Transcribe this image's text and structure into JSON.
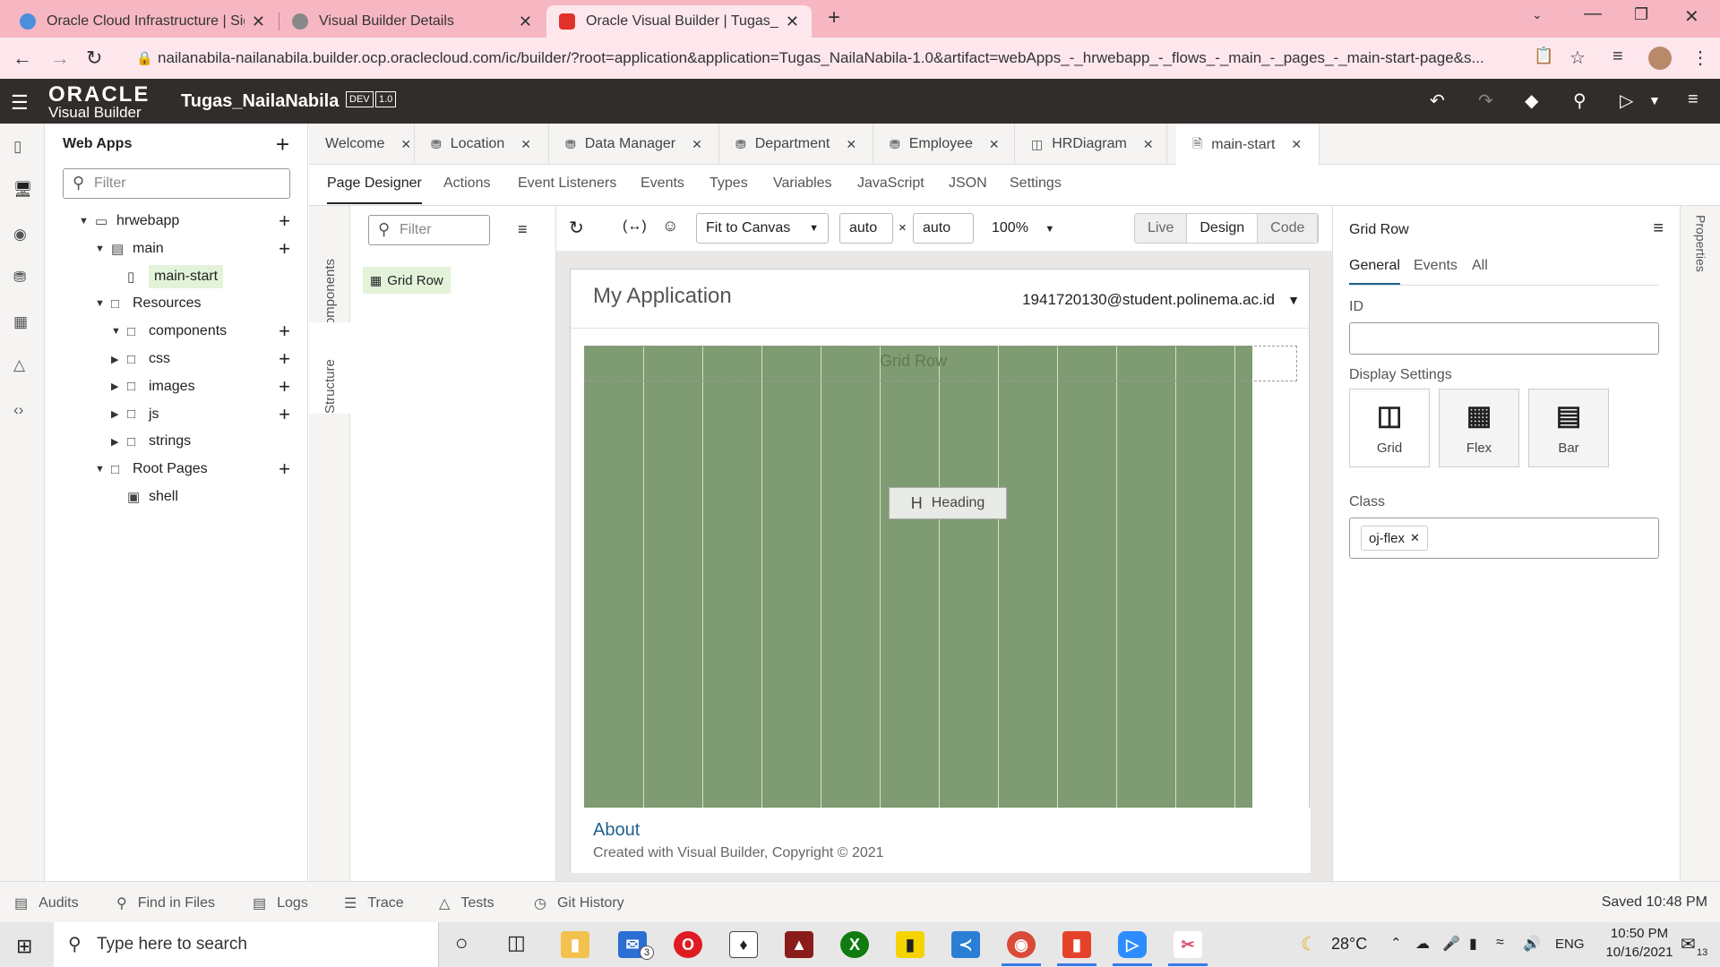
{
  "browser": {
    "tabs": [
      {
        "title": "Oracle Cloud Infrastructure | Sign",
        "close": "✕"
      },
      {
        "title": "Visual Builder Details",
        "close": "✕"
      },
      {
        "title": "Oracle Visual Builder | Tugas_Nai",
        "close": "✕"
      }
    ],
    "new_tab": "+",
    "url": "nailanabila-nailanabila.builder.ocp.oraclecloud.com/ic/builder/?root=application&application=Tugas_NailaNabila-1.0&artifact=webApps_-_hrwebapp_-_flows_-_main_-_pages_-_main-start-page&s..."
  },
  "vb_header": {
    "logo_line1": "ORACLE",
    "logo_line2": "Visual Builder",
    "app_name": "Tugas_NailaNabila",
    "badge_dev": "DEV",
    "badge_version": "1.0"
  },
  "navigator": {
    "title": "Web Apps",
    "filter_placeholder": "Filter",
    "tree": [
      {
        "label": "hrwebapp",
        "indent": 1,
        "twisty": "▼",
        "icon": "monitor-icon",
        "add": true
      },
      {
        "label": "main",
        "indent": 2,
        "twisty": "▼",
        "icon": "flow-icon",
        "add": true
      },
      {
        "label": "main-start",
        "indent": 3,
        "twisty": "",
        "icon": "page-icon",
        "add": false,
        "selected": true
      },
      {
        "label": "Resources",
        "indent": 2,
        "twisty": "▼",
        "icon": "folder-icon",
        "add": false
      },
      {
        "label": "components",
        "indent": 3,
        "twisty": "▼",
        "icon": "folder-icon",
        "add": true
      },
      {
        "label": "css",
        "indent": 3,
        "twisty": "▶",
        "icon": "folder-icon",
        "add": true
      },
      {
        "label": "images",
        "indent": 3,
        "twisty": "▶",
        "icon": "folder-icon",
        "add": true
      },
      {
        "label": "js",
        "indent": 3,
        "twisty": "▶",
        "icon": "folder-icon",
        "add": true
      },
      {
        "label": "strings",
        "indent": 3,
        "twisty": "▶",
        "icon": "folder-icon",
        "add": false
      },
      {
        "label": "Root Pages",
        "indent": 2,
        "twisty": "▼",
        "icon": "folder-icon",
        "add": true
      },
      {
        "label": "shell",
        "indent": 3,
        "twisty": "",
        "icon": "shell-icon",
        "add": false
      }
    ]
  },
  "editor_tabs": [
    "Welcome",
    "Location",
    "Data Manager",
    "Department",
    "Employee",
    "HRDiagram",
    "main-start"
  ],
  "sub_tabs": [
    "Page Designer",
    "Actions",
    "Event Listeners",
    "Events",
    "Types",
    "Variables",
    "JavaScript",
    "JSON",
    "Settings"
  ],
  "side_tabs": {
    "components": "Components",
    "structure": "Structure"
  },
  "structure": {
    "filter_placeholder": "Filter",
    "item": "Grid Row"
  },
  "toolbar": {
    "fit": "Fit to Canvas",
    "width": "auto",
    "times": "×",
    "height": "auto",
    "zoom": "100%",
    "modes": [
      "Live",
      "Design",
      "Code"
    ]
  },
  "canvas": {
    "app_title": "My Application",
    "user": "1941720130@student.polinema.ac.id",
    "grid_label": "Grid Row",
    "heading": "Heading",
    "about": "About",
    "copyright": "Created with Visual Builder, Copyright © 2021",
    "grid_color": "#7f9b72"
  },
  "properties": {
    "title": "Grid Row",
    "tabs": [
      "General",
      "Events",
      "All"
    ],
    "id_label": "ID",
    "display_label": "Display Settings",
    "display_options": [
      "Grid",
      "Flex",
      "Bar"
    ],
    "class_label": "Class",
    "class_chip": "oj-flex",
    "rail_label": "Properties"
  },
  "bottom_bar": {
    "items": [
      "Audits",
      "Find in Files",
      "Logs",
      "Trace",
      "Tests",
      "Git History"
    ],
    "saved": "Saved 10:48 PM"
  },
  "taskbar": {
    "search_placeholder": "Type here to search",
    "mail_badge": "3",
    "temperature": "28°C",
    "lang": "ENG",
    "time": "10:50 PM",
    "date": "10/16/2021",
    "notif_count": "13"
  }
}
